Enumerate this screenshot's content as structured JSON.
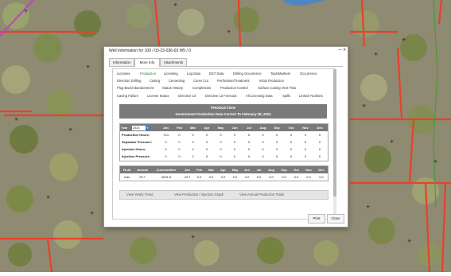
{
  "dialog": {
    "title": "Well Information for 100 / 03-23-036-03 W5 / 0",
    "minimize_glyph": "—",
    "close_glyph": "✕"
  },
  "tabs": [
    "Information",
    "More Info",
    "Attachments"
  ],
  "active_tab": "More Info",
  "sections": [
    [
      "Licenses",
      "Production",
      "Licensing",
      "Log Data",
      "DST Data",
      "Drilling Occurrence",
      "Tops/Markers",
      "Occurrence"
    ],
    [
      "Direction Drilling",
      "Casing",
      "Cementing",
      "Cores Cut",
      "Perforation/Treatment",
      "Initial Production"
    ],
    [
      "Plug Back/Abandonment",
      "Status History",
      "Completions",
      "Production Control",
      "Surface Casing Vent Flow"
    ],
    [
      "Casing Failure",
      "License Status",
      "Directive 13",
      "Directive 13 Forecast",
      "All Licensing Data",
      "Spills",
      "Linked Facilities"
    ]
  ],
  "active_section": "Production",
  "production": {
    "title": "PRODUCTION",
    "subtitle": "Government Production Data Current To February 28, 2023",
    "year_label": "Year",
    "year_value": "2023",
    "months": [
      "Jan",
      "Feb",
      "Mar",
      "Apr",
      "May",
      "Jun",
      "Jul",
      "Aug",
      "Sep",
      "Oct",
      "Nov",
      "Dec"
    ],
    "rows": [
      {
        "label": "Production Hours:",
        "values": [
          "744",
          "0",
          "0",
          "0",
          "0",
          "0",
          "0",
          "0",
          "0",
          "0",
          "0",
          "0"
        ]
      },
      {
        "label": "Separator Pressure:",
        "values": [
          "0",
          "0",
          "0",
          "0",
          "0",
          "0",
          "0",
          "0",
          "0",
          "0",
          "0",
          "0"
        ]
      },
      {
        "label": "Injection Hours:",
        "values": [
          "0",
          "0",
          "0",
          "0",
          "0",
          "0",
          "0",
          "0",
          "0",
          "0",
          "0",
          "0"
        ]
      },
      {
        "label": "Injection Pressure:",
        "values": [
          "0",
          "0",
          "0",
          "0",
          "0",
          "0",
          "0",
          "0",
          "0",
          "0",
          "0",
          "0"
        ]
      }
    ],
    "fluid_headers": [
      "Fluid",
      "Annual",
      "Cummulative",
      "Jan",
      "Feb",
      "Mar",
      "Apr",
      "May",
      "Jun",
      "Jul",
      "Aug",
      "Sep",
      "Oct",
      "Nov",
      "Dec"
    ],
    "fluid_rows": [
      [
        "Gas",
        "29.7",
        "3001.5",
        "29.7",
        "0.0",
        "0.0",
        "0.0",
        "0.0",
        "0.0",
        "0.0",
        "0.0",
        "0.0",
        "0.0",
        "0.0",
        "0.0"
      ]
    ],
    "actions": [
      "View Yearly Trend",
      "View Production / Injection Graph",
      "View Annual Production Totals"
    ]
  },
  "footer": {
    "print_label": "Print",
    "close_label": "Close"
  },
  "colors": {
    "active_link": "#2e7d32",
    "header_gray": "#7a7a7a",
    "map_road": "#e8412a",
    "map_boundary": "#4a9a3a"
  }
}
